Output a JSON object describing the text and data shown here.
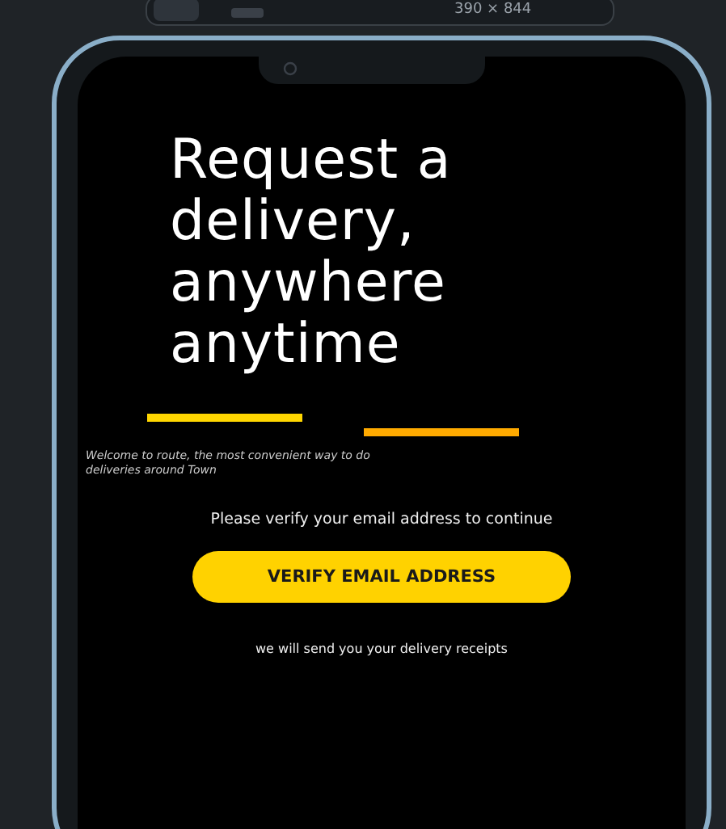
{
  "toolbar": {
    "dimensions": "390 × 844"
  },
  "screen": {
    "headline": "Request a delivery, anywhere anytime",
    "accent_bars": [
      {
        "color": "#ffd600"
      },
      {
        "color": "#ffaa00"
      }
    ],
    "welcome_text": "Welcome to route, the most convenient way to do deliveries around Town",
    "prompt": "Please verify your email address to continue",
    "button": "VERIFY EMAIL ADDRESS",
    "note": "we will send you your delivery receipts"
  }
}
